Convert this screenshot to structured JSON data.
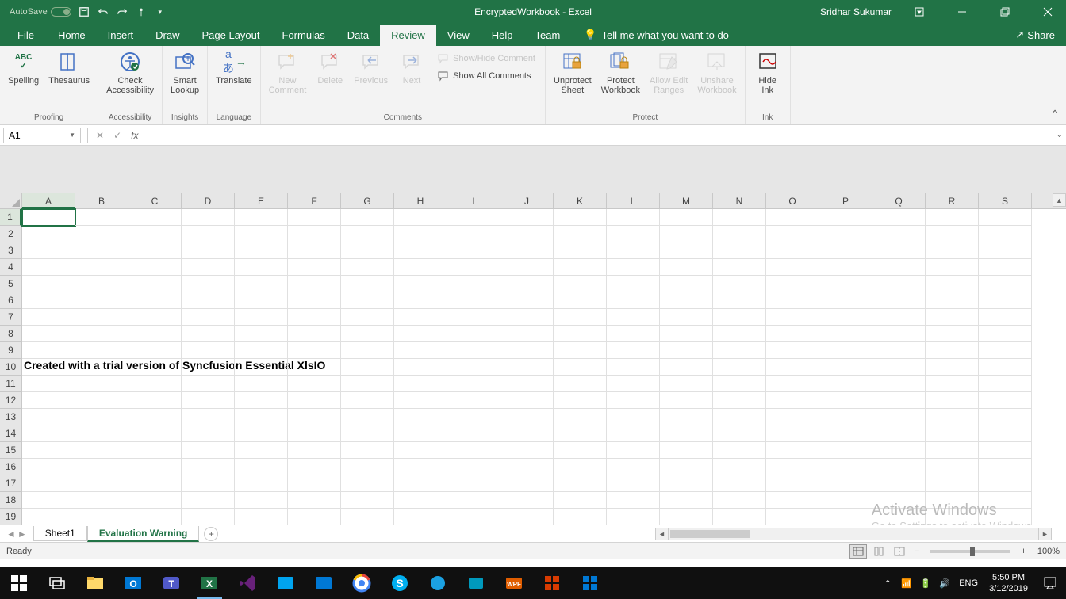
{
  "titleBar": {
    "autosave": "AutoSave",
    "autosaveState": "Off",
    "document": "EncryptedWorkbook  -  Excel",
    "user": "Sridhar Sukumar"
  },
  "ribbonTabs": {
    "file": "File",
    "home": "Home",
    "insert": "Insert",
    "draw": "Draw",
    "pageLayout": "Page Layout",
    "formulas": "Formulas",
    "data": "Data",
    "review": "Review",
    "view": "View",
    "help": "Help",
    "team": "Team",
    "tellMe": "Tell me what you want to do",
    "share": "Share"
  },
  "ribbon": {
    "proofing": {
      "spelling": "Spelling",
      "thesaurus": "Thesaurus",
      "label": "Proofing"
    },
    "accessibility": {
      "check": "Check\nAccessibility",
      "label": "Accessibility"
    },
    "insights": {
      "smart": "Smart\nLookup",
      "label": "Insights"
    },
    "language": {
      "translate": "Translate",
      "label": "Language"
    },
    "comments": {
      "new": "New\nComment",
      "delete": "Delete",
      "previous": "Previous",
      "next": "Next",
      "showHide": "Show/Hide Comment",
      "showAll": "Show All Comments",
      "label": "Comments"
    },
    "protect": {
      "unprotect": "Unprotect\nSheet",
      "protectWb": "Protect\nWorkbook",
      "allowEdit": "Allow Edit\nRanges",
      "unshare": "Unshare\nWorkbook",
      "label": "Protect"
    },
    "ink": {
      "hide": "Hide\nInk",
      "label": "Ink"
    }
  },
  "formulaBar": {
    "nameBox": "A1"
  },
  "columns": [
    "A",
    "B",
    "C",
    "D",
    "E",
    "F",
    "G",
    "H",
    "I",
    "J",
    "K",
    "L",
    "M",
    "N",
    "O",
    "P",
    "Q",
    "R",
    "S"
  ],
  "rows": [
    1,
    2,
    3,
    4,
    5,
    6,
    7,
    8,
    9,
    10,
    11,
    12,
    13,
    14,
    15,
    16,
    17,
    18,
    19
  ],
  "cellContent": {
    "A10": "Created with a trial version of Syncfusion Essential XlsIO"
  },
  "watermark": {
    "title": "Activate Windows",
    "sub": "Go to Settings to activate Windows."
  },
  "sheetTabs": {
    "sheet1": "Sheet1",
    "eval": "Evaluation Warning"
  },
  "statusBar": {
    "ready": "Ready",
    "zoom": "100%"
  },
  "tray": {
    "lang": "ENG",
    "time": "5:50 PM",
    "date": "3/12/2019"
  }
}
